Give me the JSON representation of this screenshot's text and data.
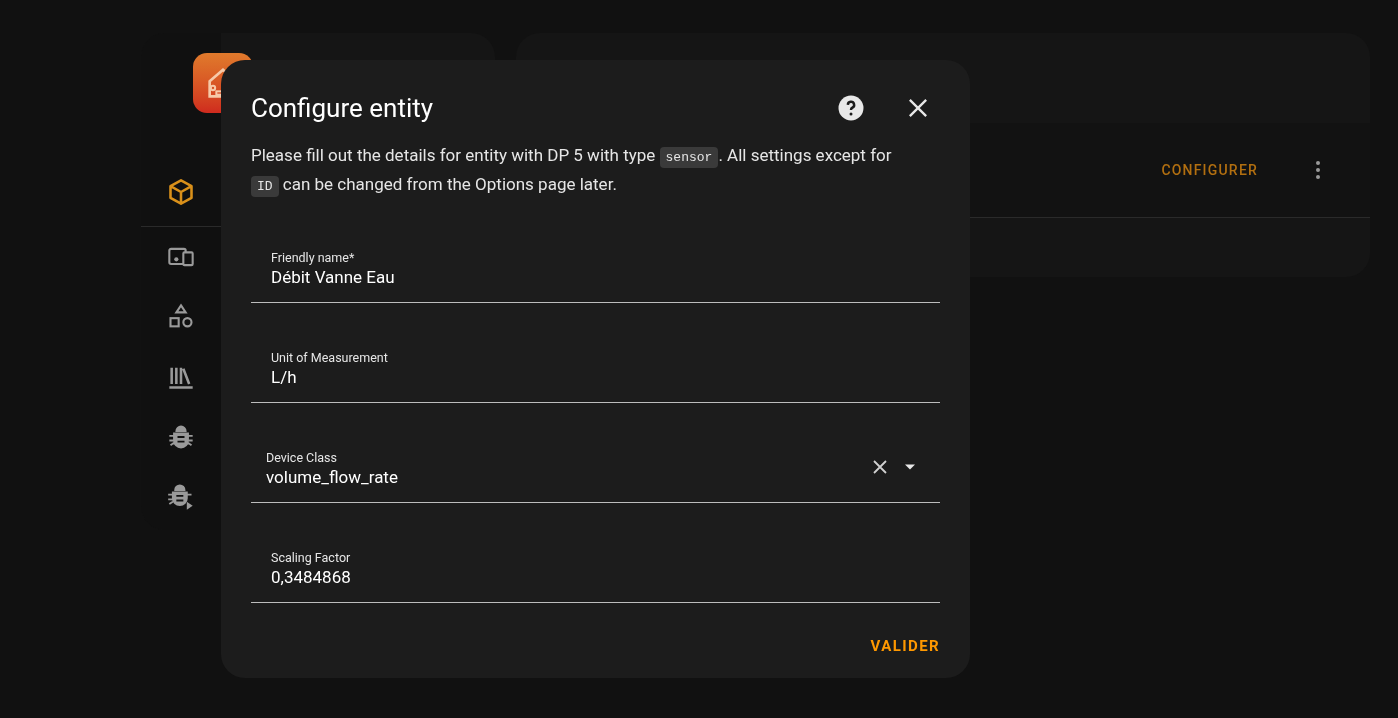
{
  "sidebar": {
    "items": [
      {
        "selected": true
      },
      {
        "selected": false
      },
      {
        "selected": false
      },
      {
        "selected": false
      },
      {
        "selected": false
      },
      {
        "selected": false
      }
    ]
  },
  "entries": {
    "configure": "CONFIGURER"
  },
  "dialog": {
    "title": "Configure entity",
    "description": [
      {
        "kind": "text",
        "text": "Please fill out the details for entity with DP 5 with type "
      },
      {
        "kind": "code",
        "text": "sensor"
      },
      {
        "kind": "text",
        "text": ". All settings except for "
      },
      {
        "kind": "code",
        "text": "ID"
      },
      {
        "kind": "text",
        "text": " can be changed from the Options page later."
      }
    ],
    "fields": [
      {
        "kind": "text",
        "label": "Friendly name*",
        "value": "Débit Vanne Eau"
      },
      {
        "kind": "text",
        "label": "Unit of Measurement",
        "value": "L/h"
      },
      {
        "kind": "select",
        "label": "Device Class",
        "value": "volume_flow_rate"
      },
      {
        "kind": "text",
        "label": "Scaling Factor",
        "value": "0,3484868"
      }
    ],
    "submit": "VALIDER"
  }
}
